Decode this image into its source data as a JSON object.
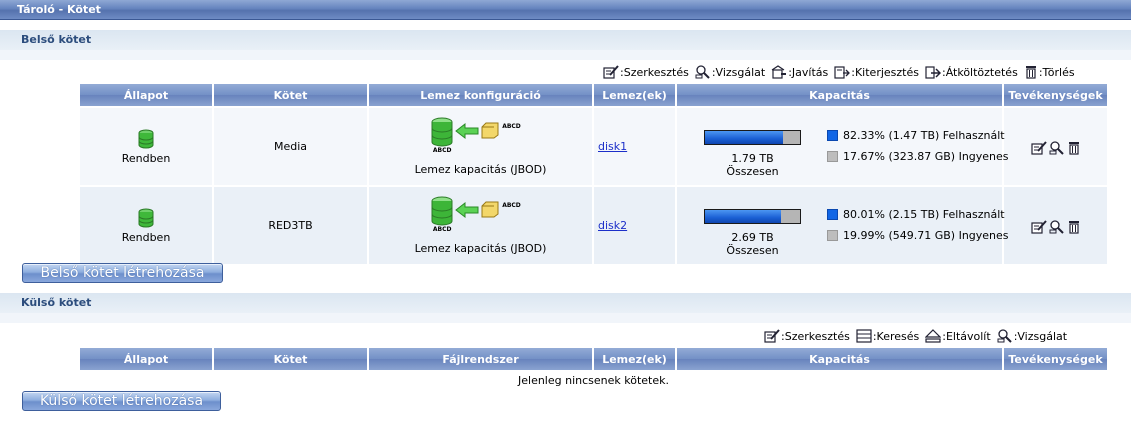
{
  "page_title": "Tároló - Kötet",
  "internal": {
    "section_title": "Belső kötet",
    "legend": [
      {
        "icon": "edit-icon",
        "label": ":Szerkesztés"
      },
      {
        "icon": "scan-icon",
        "label": ":Vizsgálat"
      },
      {
        "icon": "repair-icon",
        "label": ":Javítás"
      },
      {
        "icon": "expand-icon",
        "label": ":Kiterjesztés"
      },
      {
        "icon": "migrate-icon",
        "label": ":Átköltöztetés"
      },
      {
        "icon": "trash-icon",
        "label": ":Törlés"
      }
    ],
    "columns": [
      "Állapot",
      "Kötet",
      "Lemez konfiguráció",
      "Lemez(ek)",
      "Kapacitás",
      "Tevékenységek"
    ],
    "rows": [
      {
        "status": "Rendben",
        "volume": "Media",
        "config_label": "Lemez kapacitás (JBOD)",
        "config_tag": "ABCD",
        "disk": "disk1",
        "used_fraction": 0.8233,
        "total": "1.79 TB Összesen",
        "used": "82.33% (1.47 TB) Felhasznált",
        "free": "17.67% (323.87 GB) Ingyenes"
      },
      {
        "status": "Rendben",
        "volume": "RED3TB",
        "config_label": "Lemez kapacitás (JBOD)",
        "config_tag": "ABCD",
        "disk": "disk2",
        "used_fraction": 0.8001,
        "total": "2.69 TB Összesen",
        "used": "80.01% (2.15 TB) Felhasznált",
        "free": "19.99% (549.71 GB) Ingyenes"
      }
    ],
    "create_button": "Belső kötet létrehozása"
  },
  "external": {
    "section_title": "Külső kötet",
    "legend": [
      {
        "icon": "edit-icon",
        "label": ":Szerkesztés"
      },
      {
        "icon": "search-list-icon",
        "label": ":Keresés"
      },
      {
        "icon": "eject-icon",
        "label": ":Eltávolít"
      },
      {
        "icon": "scan-icon",
        "label": ":Vizsgálat"
      }
    ],
    "columns": [
      "Állapot",
      "Kötet",
      "Fájlrendszer",
      "Lemez(ek)",
      "Kapacitás",
      "Tevékenységek"
    ],
    "empty_message": "Jelenleg nincsenek kötetek.",
    "create_button": "Külső kötet létrehozása"
  },
  "colors": {
    "header_blue": "#7390c6",
    "used_blue": "#1166e6",
    "free_gray": "#bdbdbd",
    "link": "#1c2fc9"
  }
}
